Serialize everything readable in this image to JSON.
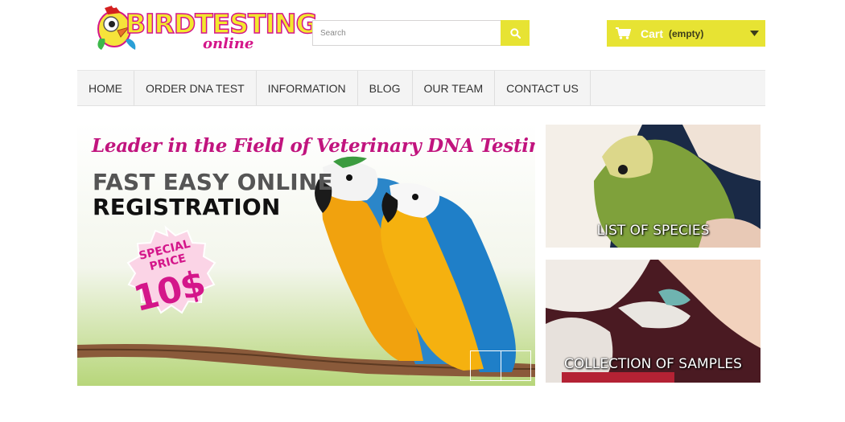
{
  "logo": {
    "main": "BIRDTESTING",
    "sub": "online"
  },
  "search": {
    "placeholder": "Search",
    "value": ""
  },
  "cart": {
    "label": "Cart",
    "status": "(empty)"
  },
  "nav": {
    "items": [
      {
        "label": "HOME"
      },
      {
        "label": "ORDER DNA TEST"
      },
      {
        "label": "INFORMATION"
      },
      {
        "label": "BLOG"
      },
      {
        "label": "OUR TEAM"
      },
      {
        "label": "CONTACT US"
      }
    ]
  },
  "hero": {
    "tagline": "Leader in the Field of Veterinary DNA Testing",
    "headline_1": "FAST EASY ONLINE",
    "headline_2": "REGISTRATION",
    "badge_line_1": "SPECIAL",
    "badge_line_2": "PRICE",
    "badge_price": "10$"
  },
  "tiles": [
    {
      "caption": "LIST OF SPECIES"
    },
    {
      "caption": "COLLECTION OF SAMPLES"
    }
  ],
  "colors": {
    "accent_yellow": "#e7e333",
    "brand_magenta": "#d4168a",
    "nav_background": "#f4f4f4"
  },
  "icons": [
    "search-icon",
    "cart-icon",
    "caret-down-icon"
  ]
}
